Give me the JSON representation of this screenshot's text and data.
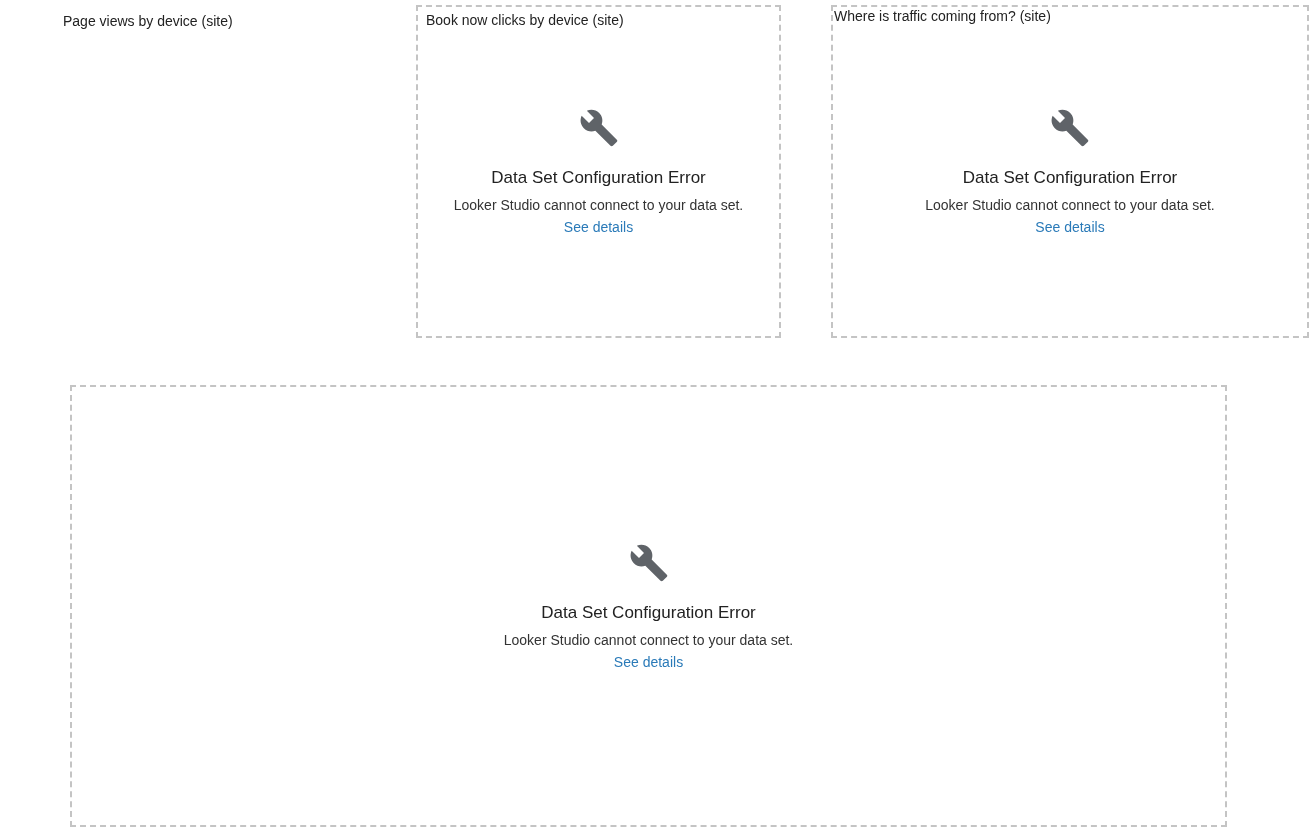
{
  "canvas": {
    "items": [
      {
        "kind": "title",
        "text": "Page views by device (site)"
      },
      {
        "kind": "error",
        "title": "Book now clicks by device (site)",
        "heading": "Data Set Configuration Error",
        "message": "Looker Studio cannot connect to your data set.",
        "link": "See details"
      },
      {
        "kind": "error",
        "title": "Where is traffic coming from? (site)",
        "heading": "Data Set Configuration Error",
        "message": "Looker Studio cannot connect to your data set.",
        "link": "See details"
      },
      {
        "kind": "error",
        "heading": "Data Set Configuration Error",
        "message": "Looker Studio cannot connect to your data set.",
        "link": "See details"
      }
    ]
  }
}
